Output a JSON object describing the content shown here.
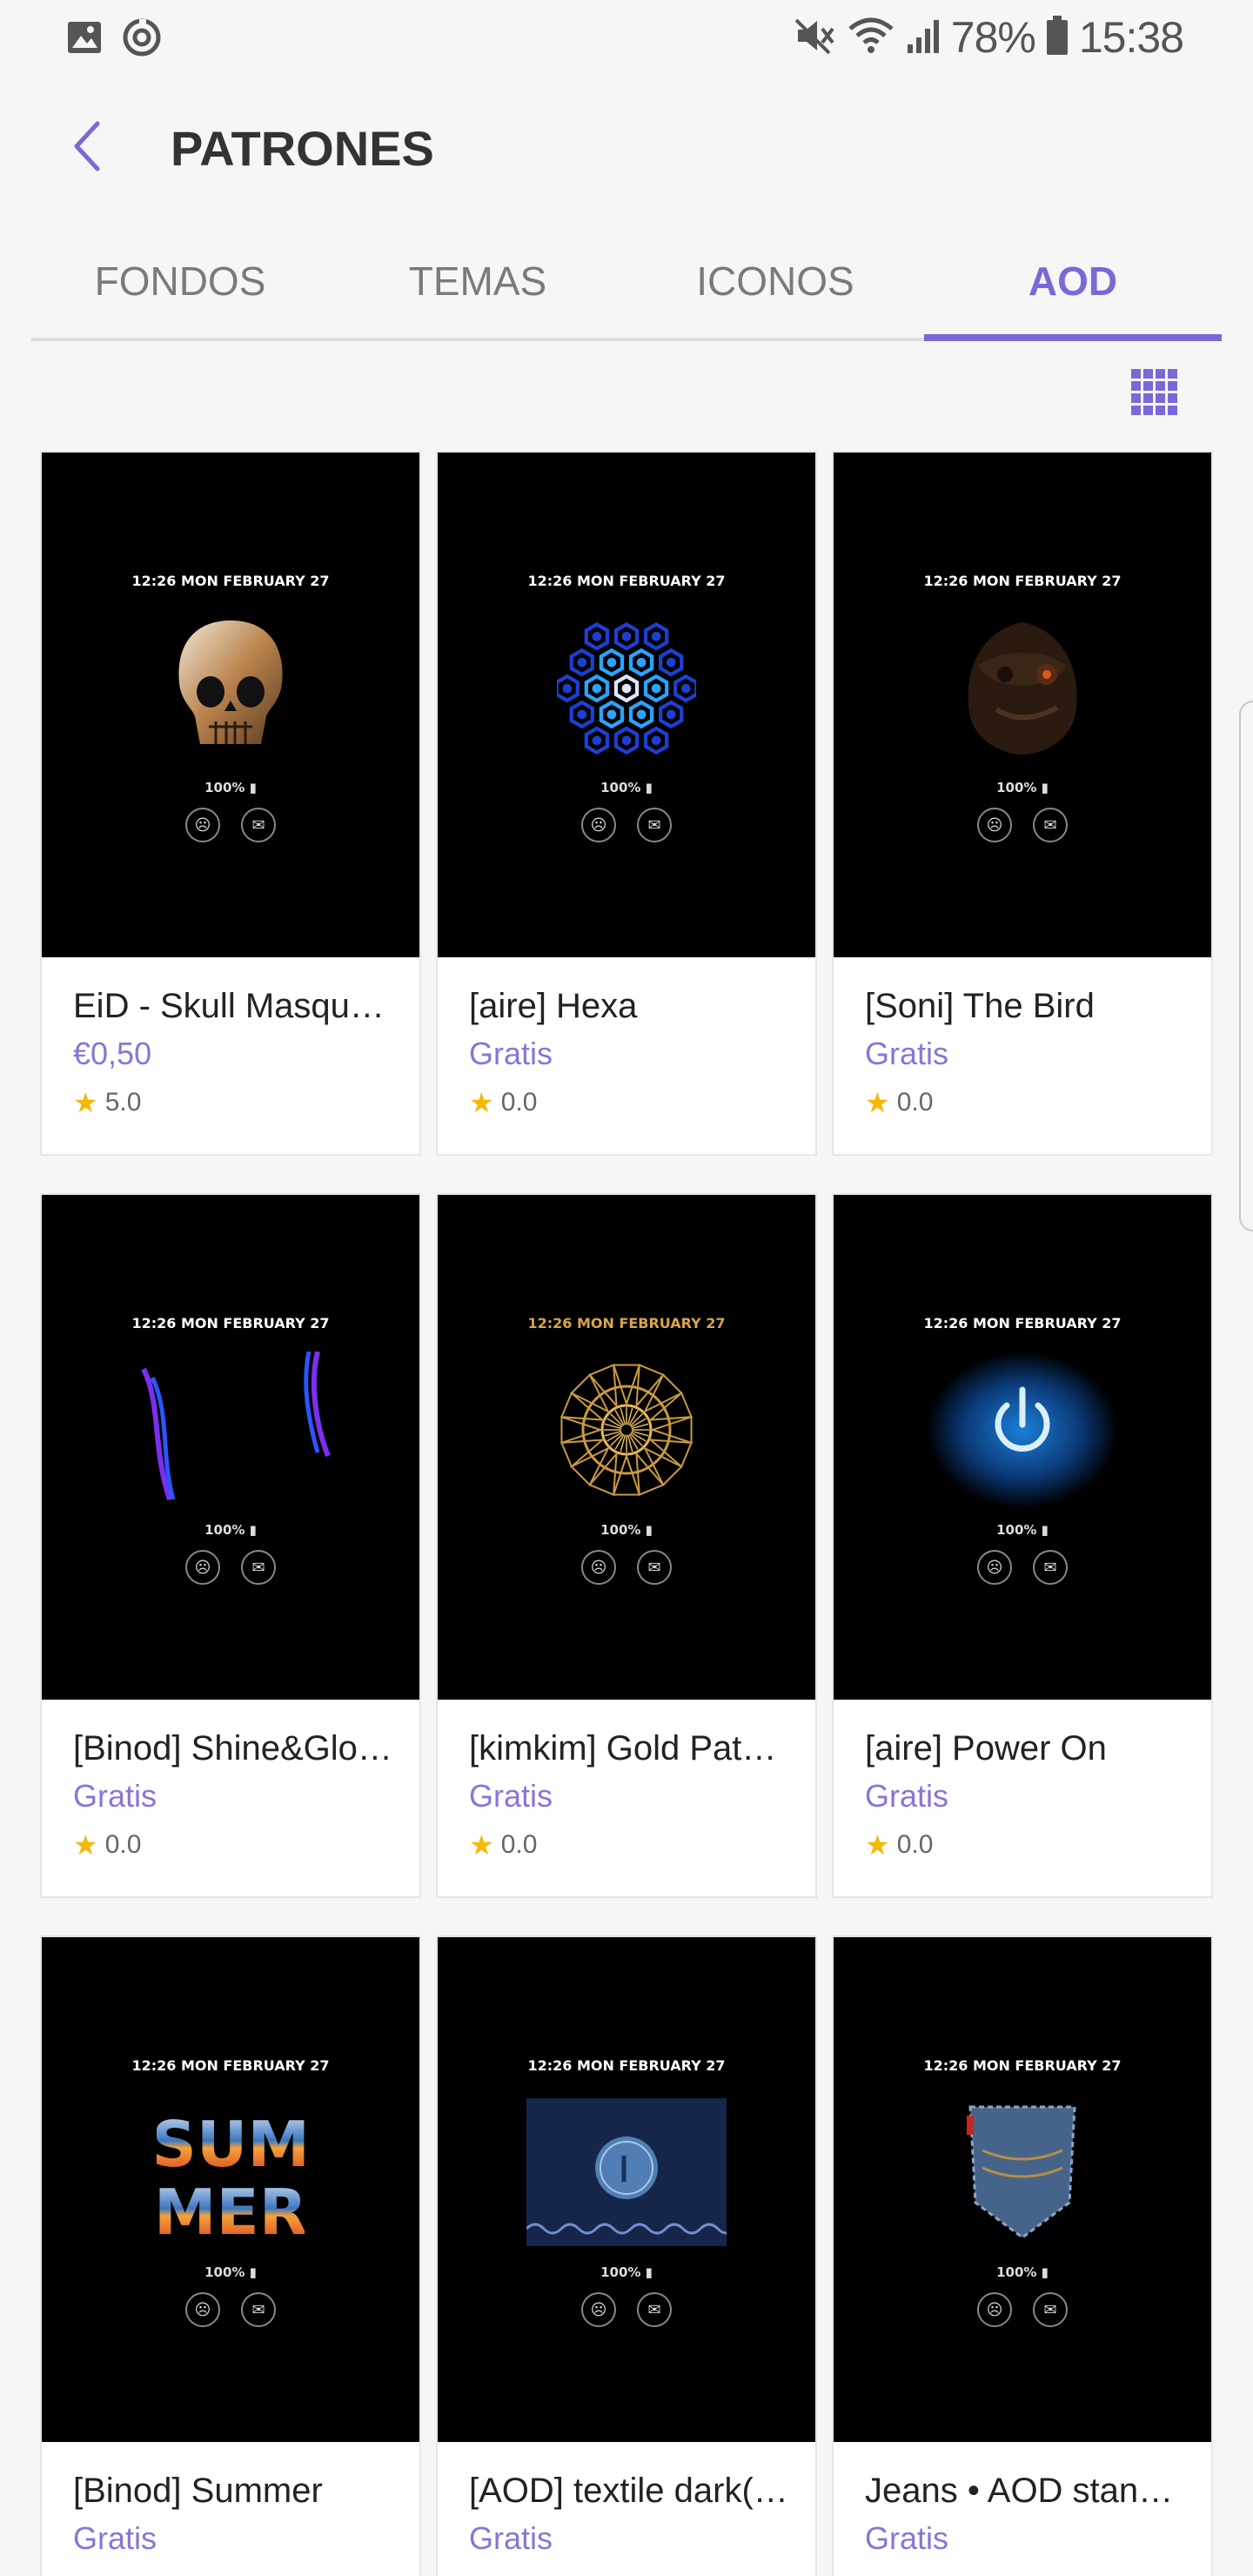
{
  "status_bar": {
    "battery": "78%",
    "time": "15:38"
  },
  "header": {
    "title": "PATRONES"
  },
  "tabs": [
    {
      "label": "FONDOS"
    },
    {
      "label": "TEMAS"
    },
    {
      "label": "ICONOS"
    },
    {
      "label": "AOD"
    }
  ],
  "preview": {
    "time": "12:26  MON FEBRUARY 27",
    "battery": "100%"
  },
  "items": [
    {
      "title": "EiD - Skull Masqu…",
      "price": "€0,50",
      "rating": "5.0",
      "art": "skull"
    },
    {
      "title": "[aire] Hexa",
      "price": "Gratis",
      "rating": "0.0",
      "art": "hexa"
    },
    {
      "title": "[Soni] The Bird",
      "price": "Gratis",
      "rating": "0.0",
      "art": "bird"
    },
    {
      "title": "[Binod] Shine&Glo…",
      "price": "Gratis",
      "rating": "0.0",
      "art": "shine"
    },
    {
      "title": "[kimkim] Gold Pat…",
      "price": "Gratis",
      "rating": "0.0",
      "art": "gold"
    },
    {
      "title": "[aire] Power On",
      "price": "Gratis",
      "rating": "0.0",
      "art": "power"
    },
    {
      "title": "[Binod] Summer",
      "price": "Gratis",
      "rating": "",
      "art": "summer"
    },
    {
      "title": "[AOD] textile dark(…",
      "price": "Gratis",
      "rating": "",
      "art": "textile"
    },
    {
      "title": "Jeans • AOD stan…",
      "price": "Gratis",
      "rating": "",
      "art": "jeans"
    }
  ],
  "colors": {
    "accent": "#7b68d8",
    "price": "#8a74d6",
    "star": "#f6b800"
  }
}
